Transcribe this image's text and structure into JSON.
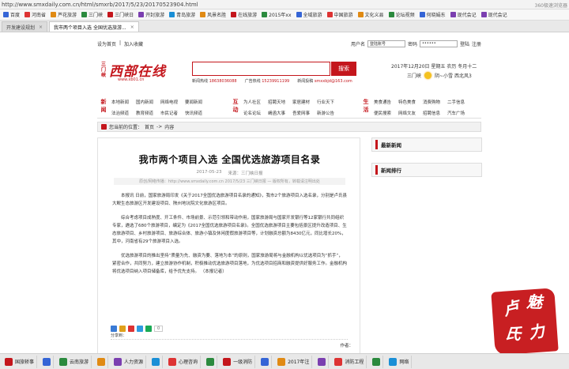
{
  "browser": {
    "url": "http://www.smxdaily.com.cn/html/smxrb/2017/5/23/20170523904.html",
    "right_text": "360极速浏览器",
    "bookmarks": [
      {
        "label": "百度",
        "color": "#3565d6"
      },
      {
        "label": "河南省",
        "color": "#d33"
      },
      {
        "label": "芦花旅游",
        "color": "#e08a14"
      },
      {
        "label": "三门峡",
        "color": "#2b8a3e"
      },
      {
        "label": "三门峡日",
        "color": "#c4161c"
      },
      {
        "label": "开封旅游",
        "color": "#7b3fb0"
      },
      {
        "label": "青岛旅游",
        "color": "#1a8fd6"
      },
      {
        "label": "风景名胜",
        "color": "#e08a14"
      },
      {
        "label": "在线旅游",
        "color": "#c4161c"
      },
      {
        "label": "2015年xx",
        "color": "#2b8a3e"
      },
      {
        "label": "全域旅游",
        "color": "#3565d6"
      },
      {
        "label": "中国旅游",
        "color": "#d33"
      },
      {
        "label": "文化义县",
        "color": "#e08a14"
      },
      {
        "label": "论坛视频",
        "color": "#2b8a3e"
      },
      {
        "label": "何晓娟东",
        "color": "#3565d6"
      },
      {
        "label": "现代会记",
        "color": "#7b3fb0"
      },
      {
        "label": "现代会记",
        "color": "#7b3fb0"
      }
    ],
    "tabs": [
      {
        "label": "开发建设规划",
        "active": false
      },
      {
        "label": "我市两个项目入选 全国优选旅游...",
        "active": true
      }
    ]
  },
  "site": {
    "topbar": {
      "set_home": "设为首页",
      "add_fav": "加入收藏",
      "username_label": "用户名",
      "username_placeholder": "登陆账号",
      "password_label": "密码",
      "password_value": "••••••",
      "login": "登陆",
      "register": "注册"
    },
    "logo": {
      "small": "三门峡",
      "big": "西部在线",
      "url": "www.xb01.cn"
    },
    "search_btn": "搜索",
    "hotlines": [
      {
        "key": "新闻热线",
        "value": "18638036088"
      },
      {
        "key": "广告热线",
        "value": "15239911199"
      },
      {
        "key": "新闻投稿",
        "value": "smxxbjd@163.com"
      }
    ],
    "date": "2017年12月20日 星期五 农历 冬月十二",
    "weather_city": "三门峡",
    "weather_text": "阴~小雪 西北风3",
    "nav": [
      {
        "head": "新闻",
        "items": [
          "本地新闻",
          "国内新闻",
          "网络电视",
          "要闻新闻",
          "法治频道",
          "教育频道",
          "市民记者",
          "快讯频道"
        ]
      },
      {
        "head": "互动",
        "items": [
          "为人社区",
          "招聘天地",
          "家居建材",
          "行业天下",
          "论名论坛",
          "崤函大事",
          "吾爱网事",
          "新游公告"
        ]
      },
      {
        "head": "生活",
        "items": [
          "美食通告",
          "特色美食",
          "消费购物",
          "二手信息",
          "便民搜索",
          "网络文友",
          "招聘信息",
          "汽车广场"
        ]
      }
    ],
    "breadcrumb": {
      "prefix": "您当前的位置：",
      "home": "首页",
      "sep": "->",
      "current": "内容"
    }
  },
  "article": {
    "title": "我市两个项目入选  全国优选旅游项目名录",
    "date": "2017-05-23",
    "source_label": "来源",
    "source": "三门峡日报",
    "source_line": "原创/网络传播：http://www.smxdaily.com.cn 2017/5/23 三门峡日报 — 版权所有，转载请注明出处",
    "paragraphs": [
      "本报讯  日前，国家旅游局印发《关于2017全国优选旅游项目名录的通知》，我市2个旅游项目入选名录，分别是卢氏县大鲵生态旅游区开发建设项目、陕州地坑院文化旅游区项目。",
      "综合考虑项目成熟度、开工条件、市场前景、示范引领和带动作用，国家旅游局与国家开发银行等12家银行共同组织专家，遴选了680个旅游项目，编定为《2017全国优选旅游项目名录》。全国优选旅游项目主要包括景区提升改造项目、生态旅游项目、乡村旅游项目、旅游综合体、旅游小镇及休闲度假旅游项目等，计划融资总额为8430亿元，同比增长20%，其中，河南省有29个旅游项目入选。",
      "优选旅游项目的推出坚持“质量为先、融资为要、落地为本”的原则，国家旅游局将与金融机构以优选项目为“抓手”，紧密合作，共同努力，建立旅游协作机制，积极推动优选旅游项目落地，为优选项目招商和融资提供好服务工作。金融机构将优选项目纳入项目储备库，给予优先支持。    （本报记者）"
    ],
    "share_label": "分享到：",
    "share_count": "0",
    "editor": "作者："
  },
  "sidebar": {
    "box1": "最新新闻",
    "box2": "新闻排行"
  },
  "seal": {
    "chars": [
      "卢",
      "魅",
      "氏",
      "力"
    ],
    "color": "#c81f22"
  },
  "taskbar": [
    {
      "label": "国旅轿事",
      "color": "#c4161c"
    },
    {
      "label": "",
      "color": "#3565d6"
    },
    {
      "label": "云南旅游",
      "color": "#2b8a3e"
    },
    {
      "label": "",
      "color": "#e08a14"
    },
    {
      "label": "人力资源",
      "color": "#7b3fb0"
    },
    {
      "label": "",
      "color": "#1a8fd6"
    },
    {
      "label": "心理咨询",
      "color": "#d33"
    },
    {
      "label": "",
      "color": "#2b8a3e"
    },
    {
      "label": "一级消防",
      "color": "#c4161c"
    },
    {
      "label": "",
      "color": "#3565d6"
    },
    {
      "label": "2017年注",
      "color": "#e08a14"
    },
    {
      "label": "",
      "color": "#7b3fb0"
    },
    {
      "label": "消防工程",
      "color": "#d33"
    },
    {
      "label": "",
      "color": "#2b8a3e"
    },
    {
      "label": "网络",
      "color": "#1a8fd6"
    }
  ]
}
